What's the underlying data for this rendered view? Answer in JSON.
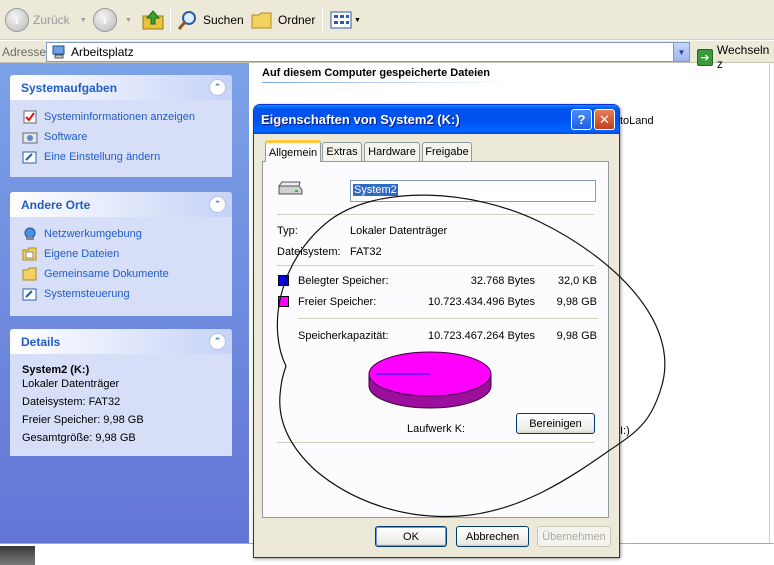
{
  "toolbar": {
    "back_label": "Zurück",
    "search_label": "Suchen",
    "folders_label": "Ordner"
  },
  "address": {
    "label": "Adresse",
    "value": "Arbeitsplatz",
    "go_label": "Wechseln z"
  },
  "left_pane": {
    "system_tasks": {
      "title": "Systemaufgaben",
      "items": [
        "Systeminformationen anzeigen",
        "Software",
        "Eine Einstellung ändern"
      ]
    },
    "other_places": {
      "title": "Andere Orte",
      "items": [
        "Netzwerkumgebung",
        "Eigene Dateien",
        "Gemeinsame Dokumente",
        "Systemsteuerung"
      ]
    },
    "details": {
      "title": "Details",
      "lines": [
        "System2 (K:)",
        "Lokaler Datenträger",
        "Dateisystem: FAT32",
        "Freier Speicher: 9,98 GB",
        "Gesamtgröße: 9,98 GB"
      ]
    }
  },
  "content": {
    "heading": "Auf diesem Computer gespeicherte Dateien",
    "bg_snippet_1": "toLand",
    "bg_snippet_2": "I:)"
  },
  "dialog": {
    "title": "Eigenschaften von System2 (K:)",
    "tabs": [
      "Allgemein",
      "Extras",
      "Hardware",
      "Freigabe"
    ],
    "drive_name": "System2",
    "type_label": "Typ:",
    "type_value": "Lokaler Datenträger",
    "fs_label": "Dateisystem:",
    "fs_value": "FAT32",
    "used_label": "Belegter Speicher:",
    "used_bytes": "32.768 Bytes",
    "used_size": "32,0 KB",
    "free_label": "Freier Speicher:",
    "free_bytes": "10.723.434.496 Bytes",
    "free_size": "9,98 GB",
    "capacity_label": "Speicherkapazität:",
    "capacity_bytes": "10.723.467.264 Bytes",
    "capacity_size": "9,98 GB",
    "drive_label": "Laufwerk K:",
    "cleanup_button": "Bereinigen",
    "ok_button": "OK",
    "cancel_button": "Abbrechen",
    "apply_button": "Übernehmen",
    "colors": {
      "used": "#0000FF",
      "free": "#FF00FF"
    }
  }
}
